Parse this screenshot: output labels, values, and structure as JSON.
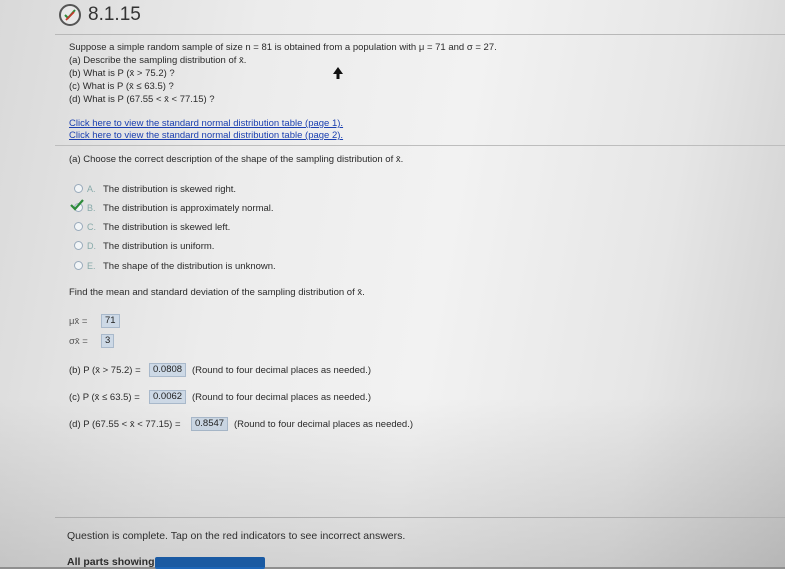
{
  "header": {
    "question_number": "8.1.15"
  },
  "question": {
    "line1": "Suppose a simple random sample of size n = 81 is obtained from a population with μ = 71 and σ = 27.",
    "part_a": "(a) Describe the sampling distribution of x̄.",
    "part_b": "(b) What is P (x̄ > 75.2) ?",
    "part_c": "(c) What is P (x̄ ≤ 63.5) ?",
    "part_d": "(d) What is P (67.55 < x̄ < 77.15) ?"
  },
  "links": {
    "table_page1": "Click here to view the standard normal distribution table (page 1).",
    "table_page2": "Click here to view the standard normal distribution table (page 2)."
  },
  "part_a": {
    "prompt": "(a) Choose the correct description of the shape of the sampling distribution of x̄.",
    "options": [
      {
        "letter": "A.",
        "text": "The distribution is skewed right."
      },
      {
        "letter": "B.",
        "text": "The distribution is approximately normal."
      },
      {
        "letter": "C.",
        "text": "The distribution is skewed left."
      },
      {
        "letter": "D.",
        "text": "The distribution is uniform."
      },
      {
        "letter": "E.",
        "text": "The shape of the distribution is unknown."
      }
    ],
    "selected": "B"
  },
  "mean_sd": {
    "prompt": "Find the mean and standard deviation of the sampling distribution of x̄.",
    "mu_label": "μx̄ =",
    "mu_value": "71",
    "sigma_label": "σx̄ =",
    "sigma_value": "3"
  },
  "answers": {
    "b_label": "(b) P (x̄ > 75.2) =",
    "b_value": "0.0808",
    "c_label": "(c) P (x̄ ≤ 63.5) =",
    "c_value": "0.0062",
    "d_label": "(d) P (67.55 < x̄ < 77.15) =",
    "d_value": "0.8547",
    "round_note": "(Round to four decimal places as needed.)"
  },
  "status": {
    "message": "Question is complete. Tap on the red indicators to see incorrect answers.",
    "footer_label": "All parts showing"
  },
  "colors": {
    "link": "#1a3fb0",
    "answer_box": "#cdd9e6",
    "check": "#2e8b3a",
    "footer_button": "#1d66b8"
  }
}
